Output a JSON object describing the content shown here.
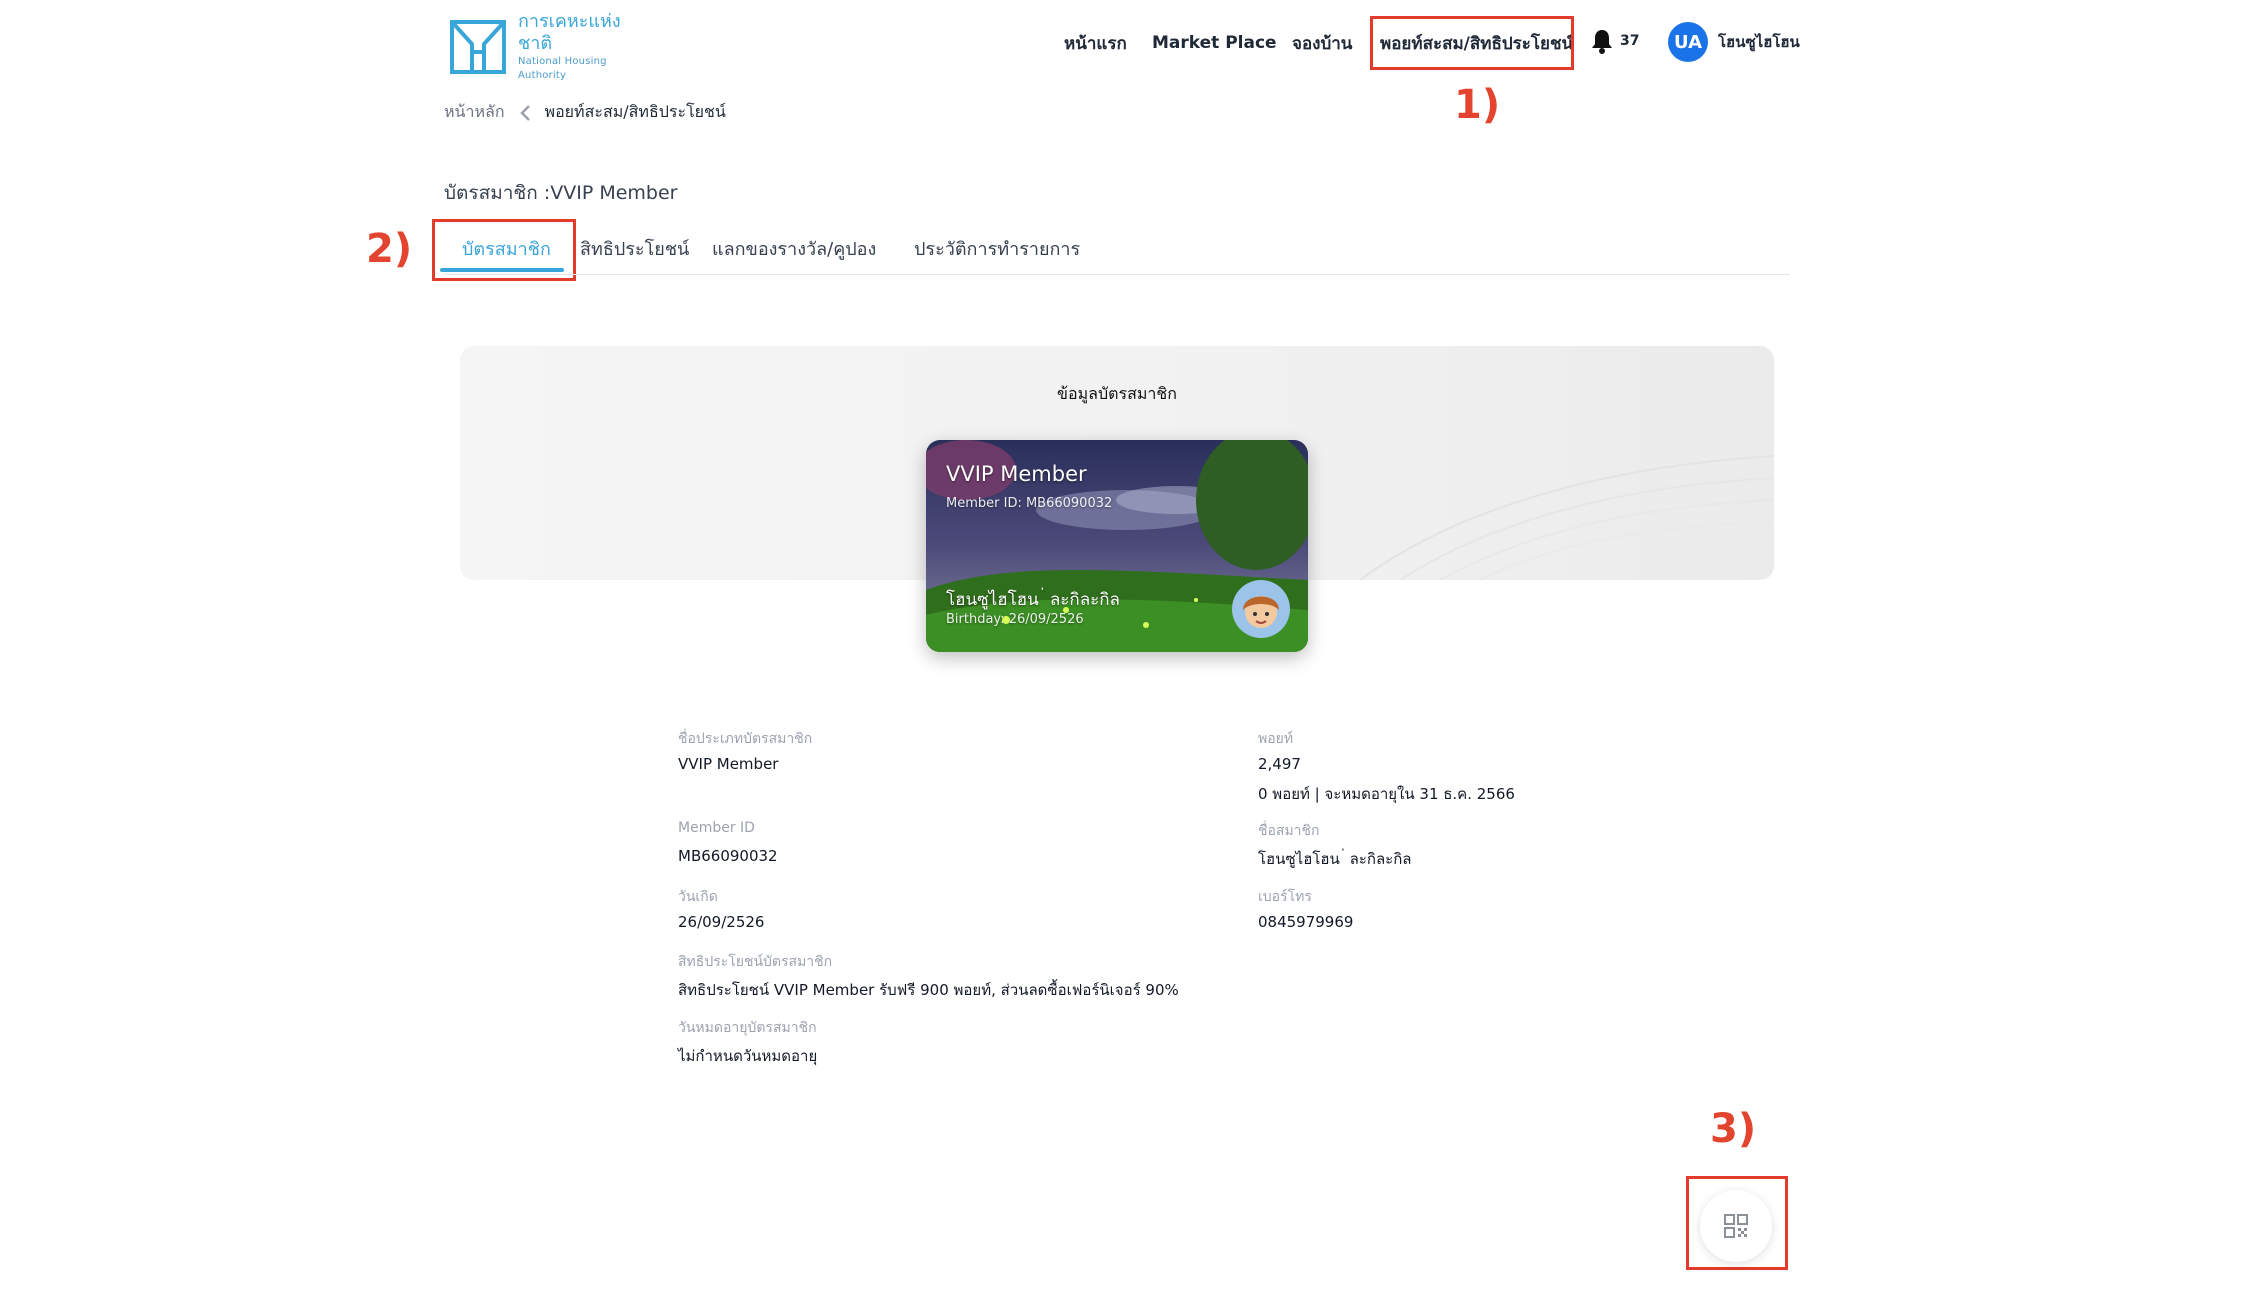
{
  "header": {
    "logo_th": "การเคหะแห่งชาติ",
    "logo_en": "National Housing Authority",
    "nav": {
      "home": "หน้าแรก",
      "market": "Market Place",
      "booking": "จองบ้าน",
      "points": "พอยท์สะสม/สิทธิประโยชน์"
    },
    "notification_count": "37",
    "user_initials": "UA",
    "user_name": "โฮนซูไฮโฮน"
  },
  "annotations": {
    "one": "1)",
    "two": "2)",
    "three": "3)"
  },
  "breadcrumb": {
    "home": "หน้าหลัก",
    "current": "พอยท์สะสม/สิทธิประโยชน์"
  },
  "page_title": "บัตรสมาชิก :VVIP Member",
  "tabs": [
    {
      "label": "บัตรสมาชิก"
    },
    {
      "label": "สิทธิประโยชน์"
    },
    {
      "label": "แลกของรางวัล/คูปอง"
    },
    {
      "label": "ประวัติการทำรายการ"
    }
  ],
  "banner_title": "ข้อมูลบัตรสมาชิก",
  "card": {
    "tier": "VVIP Member",
    "member_id": "Member ID:  MB66090032",
    "name": "โฮนซูไฮโฮน ่ ละกิละกิล",
    "birthday": "Birthday:  26/09/2526"
  },
  "details": {
    "type_label": "ชื่อประเภทบัตรสมาชิก",
    "type_value": "VVIP Member",
    "points_label": "พอยท์",
    "points_value": "2,497",
    "points_expiry": "0 พอยท์ | จะหมดอายุใน 31 ธ.ค. 2566",
    "member_id_label": "Member ID",
    "member_id_value": "MB66090032",
    "member_name_label": "ชื่อสมาชิก",
    "member_name_value": "โฮนซูไฮโฮน ่ ละกิละกิล",
    "birth_label": "วันเกิด",
    "birth_value": "26/09/2526",
    "phone_label": "เบอร์โทร",
    "phone_value": "0845979969",
    "benefit_label": "สิทธิประโยชน์บัตรสมาชิก",
    "benefit_value": "สิทธิประโยชน์ VVIP Member รับฟรี 900 พอยท์, ส่วนลดซื้อเฟอร์นิเจอร์ 90%",
    "expiry_label": "วันหมดอายุบัตรสมาชิก",
    "expiry_value": "ไม่กำหนดวันหมดอายุ"
  },
  "colors": {
    "accent": "#38a6d9",
    "annotation_red": "#e23a2b",
    "avatar_blue": "#1a73e8"
  },
  "icons": {
    "bell": "bell-icon",
    "chevron": "chevron-left-icon",
    "qr": "qr-code-icon"
  }
}
